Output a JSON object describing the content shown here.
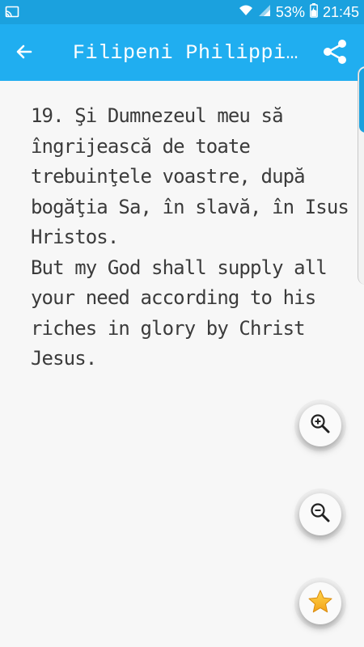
{
  "status_bar": {
    "battery_percent": "53%",
    "time": "21:45",
    "icons": [
      "cast-icon",
      "wifi-icon",
      "signal-icon",
      "battery-icon"
    ]
  },
  "app_bar": {
    "title": "Filipeni Philippi…",
    "back_icon": "back-arrow-icon",
    "share_icon": "share-icon",
    "color": "#20aef0"
  },
  "verse": {
    "romanian": "19. Şi Dumnezeul meu să îngrijească de toate trebuinţele voastre, după bogăţia Sa, în slavă, în Isus Hristos.",
    "english": "But my God shall supply all your need according to his riches in glory by Christ Jesus."
  },
  "fabs": [
    {
      "name": "zoom-in",
      "icon": "zoom-in-icon"
    },
    {
      "name": "zoom-out",
      "icon": "zoom-out-icon"
    },
    {
      "name": "favorite",
      "icon": "star-icon"
    }
  ]
}
